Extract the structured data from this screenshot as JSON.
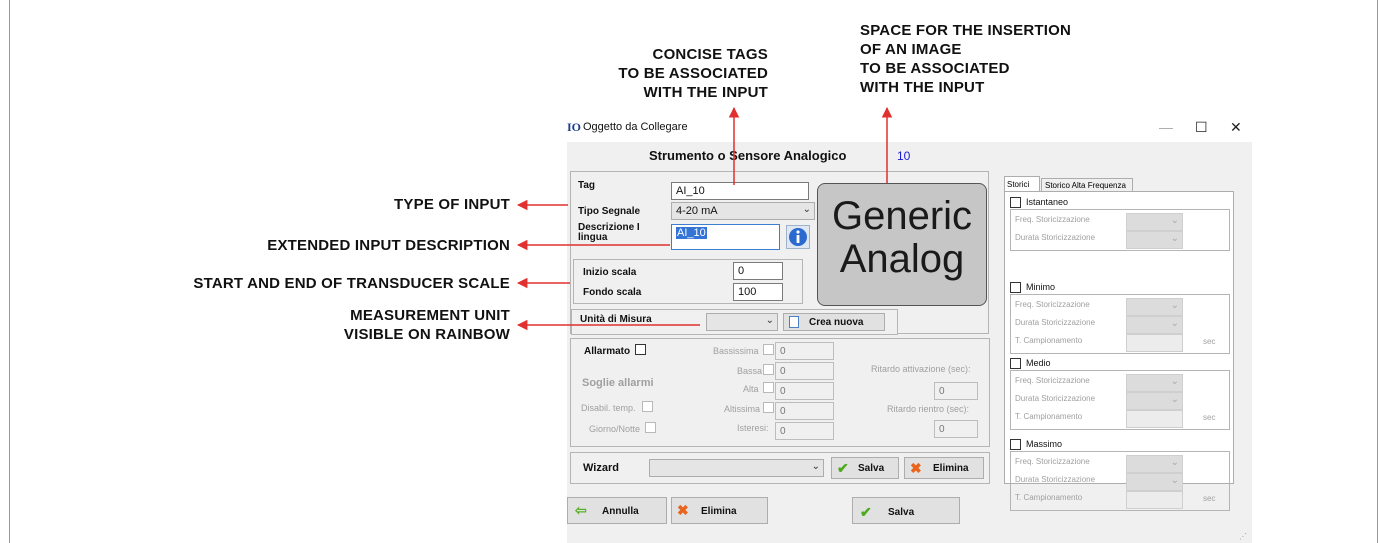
{
  "callouts": {
    "concise_tags": [
      "CONCISE TAGS",
      "TO BE ASSOCIATED",
      "WITH THE INPUT"
    ],
    "image_space": [
      "SPACE FOR THE INSERTION",
      "OF AN IMAGE",
      "TO BE ASSOCIATED",
      "WITH THE INPUT"
    ],
    "type_of_input": "TYPE OF INPUT",
    "extended_description": "EXTENDED INPUT DESCRIPTION",
    "transducer_scale": "START AND END OF TRANSDUCER SCALE",
    "measurement_unit": [
      "MEASUREMENT UNIT",
      "VISIBLE ON RAINBOW"
    ]
  },
  "colors": {
    "arrow": "#e0302f",
    "window_bg": "#f0f0f0",
    "title_accent": "#1a1ad8"
  },
  "window": {
    "title": "Oggetto da Collegare",
    "app_icon_text": "IO",
    "controls": {
      "minimize": "—",
      "maximize": "☐",
      "close": "✕"
    },
    "heading": "Strumento o Sensore Analogico",
    "heading_number": "10"
  },
  "form": {
    "tag_label": "Tag",
    "tag_value": "AI_10",
    "signal_type_label": "Tipo Segnale",
    "signal_type_value": "4-20 mA",
    "description_label": "Descrizione I lingua",
    "description_value": "AI_10",
    "info_icon": "info-icon",
    "image_text_line1": "Generic",
    "image_text_line2": "Analog",
    "scale_start_label": "Inizio scala",
    "scale_start_value": "0",
    "scale_end_label": "Fondo scala",
    "scale_end_value": "100",
    "unit_label": "Unità di Misura",
    "unit_value": "",
    "create_new_button": "Crea nuova"
  },
  "alarms": {
    "alarmed_label": "Allarmato",
    "thresholds_label": "Soglie allarmi",
    "very_low_label": "Bassissima",
    "very_low_value": "0",
    "low_label": "Bassa",
    "low_value": "0",
    "high_label": "Alta",
    "high_value": "0",
    "very_high_label": "Altissima",
    "very_high_value": "0",
    "hysteresis_label": "Isteresi:",
    "hysteresis_value": "0",
    "activation_delay_label": "Ritardo attivazione (sec):",
    "activation_delay_value": "0",
    "return_delay_label": "Ritardo rientro (sec):",
    "return_delay_value": "0",
    "temp_disable_label": "Disabil. temp.",
    "day_night_label": "Giorno/Notte"
  },
  "wizard": {
    "label": "Wizard",
    "value": "",
    "save_button": "Salva",
    "delete_button": "Elimina"
  },
  "bottom_buttons": {
    "cancel": "Annulla",
    "delete": "Elimina",
    "save": "Salva"
  },
  "history": {
    "tabs": [
      "Storici",
      "Storico Alta Frequenza"
    ],
    "sections": [
      {
        "title": "Istantaneo",
        "rows": [
          "Freq. Storicizzazione",
          "Durata Storicizzazione"
        ]
      },
      {
        "title": "Minimo",
        "rows": [
          "Freq. Storicizzazione",
          "Durata Storicizzazione",
          "T. Campionamento"
        ],
        "unit": "sec"
      },
      {
        "title": "Medio",
        "rows": [
          "Freq. Storicizzazione",
          "Durata Storicizzazione",
          "T. Campionamento"
        ],
        "unit": "sec"
      },
      {
        "title": "Massimo",
        "rows": [
          "Freq. Storicizzazione",
          "Durata Storicizzazione",
          "T. Campionamento"
        ],
        "unit": "sec"
      }
    ]
  }
}
